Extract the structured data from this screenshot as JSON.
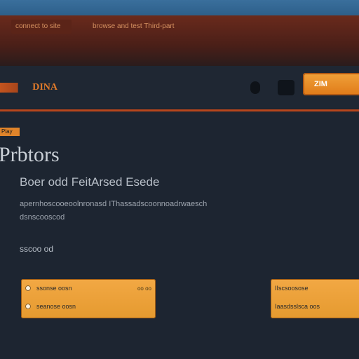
{
  "menubar": {
    "item_a": "connect to site",
    "item_b": "browse and test   Third-part"
  },
  "navbar": {
    "logo": "DINA",
    "cta_label": "ZIM"
  },
  "breadcrumb": "Play",
  "main": {
    "title": "Prbtors",
    "subtitle": "Boer odd FeitArsed Esede",
    "description_line1": "apernhoscooeoolnronasd IThassadscoonnoadrwaesch",
    "description_line2": "dsnscooscod",
    "section_heading": "sscoo od"
  },
  "cards": {
    "left": {
      "row1_label": "ssonse oosn",
      "row1_tag": "oo oo",
      "row2_label": "seanose oosn"
    },
    "right": {
      "row1_label": "IIscsoosose",
      "row2_label": "Iaasdsslsca oos"
    }
  },
  "colors": {
    "accent": "#e08a2a",
    "bg": "#1d2531",
    "header_red": "#5b2418",
    "divider": "#b8461c"
  }
}
